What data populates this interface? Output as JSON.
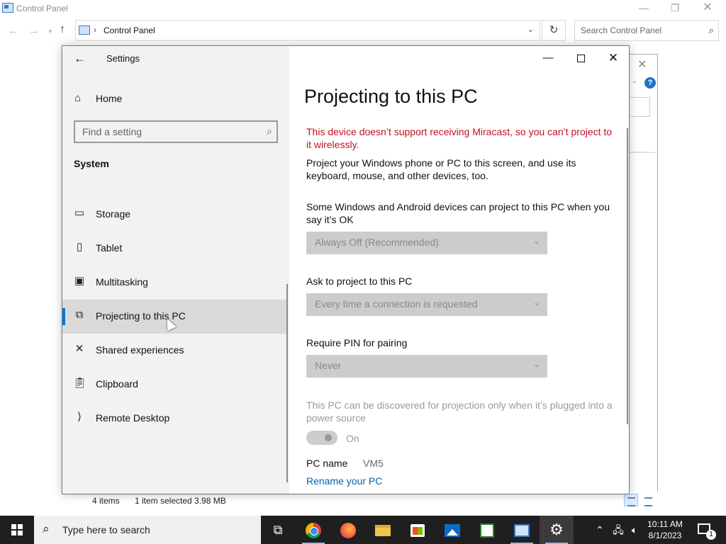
{
  "control_panel": {
    "title": "Control Panel",
    "address": {
      "separator": "›",
      "path": "Control Panel"
    },
    "search_placeholder": "Search Control Panel",
    "status": {
      "items": "4 items",
      "selected": "1 item selected  3.98 MB"
    }
  },
  "settings": {
    "app_title": "Settings",
    "home_label": "Home",
    "search_placeholder": "Find a setting",
    "section": "System",
    "nav_items": [
      {
        "label": "Storage",
        "icon": "storage-icon",
        "selected": false
      },
      {
        "label": "Tablet",
        "icon": "tablet-icon",
        "selected": false
      },
      {
        "label": "Multitasking",
        "icon": "multitasking-icon",
        "selected": false
      },
      {
        "label": "Projecting to this PC",
        "icon": "projecting-icon",
        "selected": true
      },
      {
        "label": "Shared experiences",
        "icon": "shared-experiences-icon",
        "selected": false
      },
      {
        "label": "Clipboard",
        "icon": "clipboard-icon",
        "selected": false
      },
      {
        "label": "Remote Desktop",
        "icon": "remote-desktop-icon",
        "selected": false
      }
    ],
    "page": {
      "title": "Projecting to this PC",
      "warning": "This device doesn’t support receiving Miracast, so you can’t project to it wirelessly.",
      "intro": "Project your Windows phone or PC to this screen, and use its keyboard, mouse, and other devices, too.",
      "setting1_label": "Some Windows and Android devices can project to this PC when you say it’s OK",
      "setting1_value": "Always Off (Recommended)",
      "setting2_label": "Ask to project to this PC",
      "setting2_value": "Every time a connection is requested",
      "setting3_label": "Require PIN for pairing",
      "setting3_value": "Never",
      "power_note": "This PC can be discovered for projection only when it’s plugged into a power source",
      "toggle_label": "On",
      "toggle_on": true,
      "pc_name_label": "PC name",
      "pc_name_value": "VM5",
      "rename_link": "Rename your PC"
    },
    "accent_color": "#0078d7",
    "warning_color": "#c50f1f"
  },
  "taskbar": {
    "search_placeholder": "Type here to search",
    "time": "10:11 AM",
    "date": "8/1/2023",
    "notification_count": "1"
  }
}
